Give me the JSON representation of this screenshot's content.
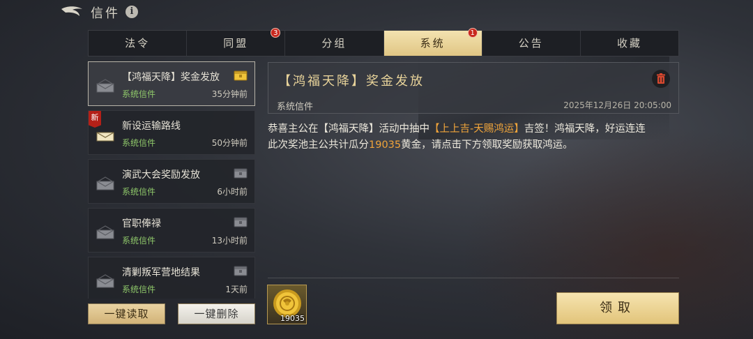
{
  "header": {
    "title": "信件",
    "back_icon": "back-arrow-icon",
    "info_icon": "info-icon",
    "info_glyph": "i"
  },
  "tabs": [
    {
      "label": "法令",
      "badge": null,
      "active": false
    },
    {
      "label": "同盟",
      "badge": "3",
      "active": false
    },
    {
      "label": "分组",
      "badge": null,
      "active": false
    },
    {
      "label": "系统",
      "badge": "1",
      "active": true
    },
    {
      "label": "公告",
      "badge": null,
      "active": false
    },
    {
      "label": "收藏",
      "badge": null,
      "active": false
    }
  ],
  "mails": [
    {
      "title": "【鸿福天降】奖金发放",
      "sender": "系统信件",
      "time": "35分钟前",
      "selected": true,
      "new": false,
      "has_gift": true,
      "gift_gold": true,
      "envelope_open": true
    },
    {
      "title": "新设运输路线",
      "sender": "系统信件",
      "time": "50分钟前",
      "selected": false,
      "new": true,
      "new_label": "新",
      "has_gift": false,
      "envelope_open": false
    },
    {
      "title": "演武大会奖励发放",
      "sender": "系统信件",
      "time": "6小时前",
      "selected": false,
      "new": false,
      "has_gift": true,
      "gift_gold": false,
      "envelope_open": true
    },
    {
      "title": "官职俸禄",
      "sender": "系统信件",
      "time": "13小时前",
      "selected": false,
      "new": false,
      "has_gift": true,
      "gift_gold": false,
      "envelope_open": true
    },
    {
      "title": "清剿叛军营地结果",
      "sender": "系统信件",
      "time": "1天前",
      "selected": false,
      "new": false,
      "has_gift": true,
      "gift_gold": false,
      "envelope_open": true
    }
  ],
  "actions": {
    "read_all": "一键读取",
    "delete_all": "一键删除"
  },
  "detail": {
    "title": "【鸿福天降】奖金发放",
    "sender": "系统信件",
    "date": "2025年12月26日 20:05:00",
    "body_parts": [
      {
        "text": "恭喜主公在【鸿福天降】活动中抽中",
        "hl": false
      },
      {
        "text": "【上上吉-天赐鸿运】",
        "hl": true
      },
      {
        "text": "吉签！鸿福天降，好运连连",
        "hl": false
      },
      {
        "text": "此次奖池主公共计瓜分",
        "hl": false,
        "break_before": true
      },
      {
        "text": "19035",
        "hl": true
      },
      {
        "text": "黄金，请点击下方领取奖励获取鸿运。",
        "hl": false
      }
    ],
    "reward": {
      "icon": "gold-coin-icon",
      "count": "19035"
    },
    "claim_label": "领取"
  },
  "colors": {
    "accent_gold": "#e8d39a",
    "highlight": "#f0a43a",
    "sender_green": "#8fc86a",
    "badge_red": "#c8281e"
  }
}
